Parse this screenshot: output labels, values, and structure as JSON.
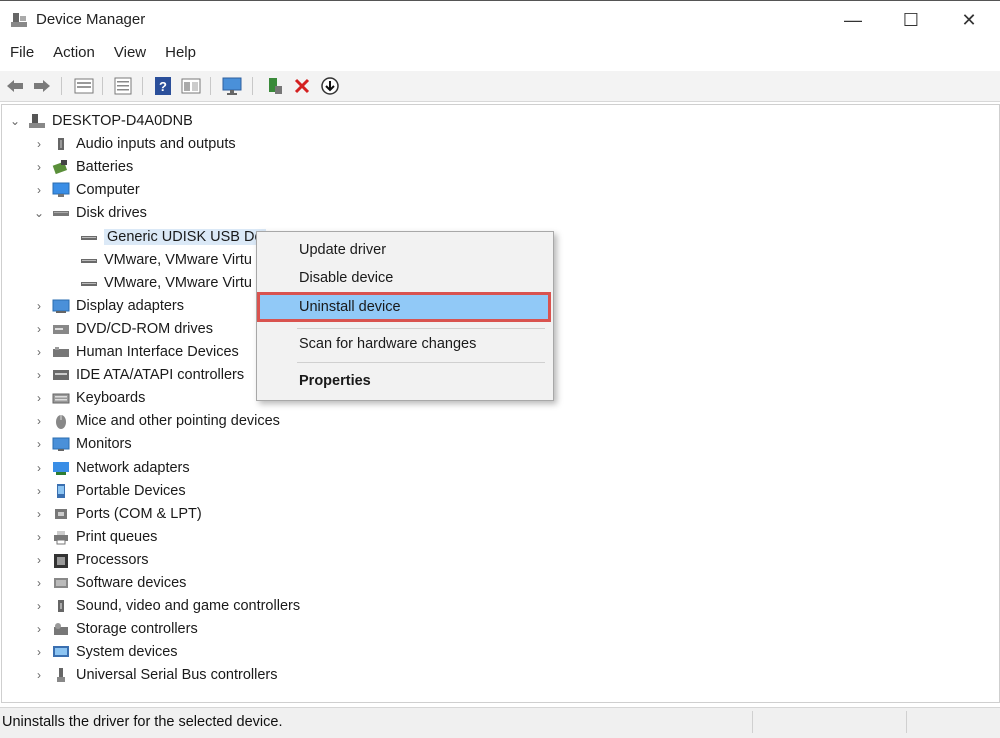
{
  "window": {
    "title": "Device Manager",
    "minimize_glyph": "—",
    "maximize_glyph": "☐",
    "close_glyph": "✕"
  },
  "menu": [
    "File",
    "Action",
    "View",
    "Help"
  ],
  "toolbar": {
    "icons": [
      "back-arrow-icon",
      "forward-arrow-icon",
      "properties-grid-icon",
      "list-view-icon",
      "help-icon",
      "resources-icon",
      "monitor-scan-icon",
      "update-driver-icon",
      "uninstall-x-icon",
      "download-icon"
    ]
  },
  "tree": {
    "root": "DESKTOP-D4A0DNB",
    "categories": [
      {
        "label": "Audio inputs and outputs",
        "icon": "speaker-icon",
        "expanded": false
      },
      {
        "label": "Batteries",
        "icon": "battery-icon",
        "expanded": false
      },
      {
        "label": "Computer",
        "icon": "computer-icon",
        "expanded": false
      },
      {
        "label": "Disk drives",
        "icon": "disk-drive-icon",
        "expanded": true,
        "children": [
          "Generic UDISK USB De",
          "VMware, VMware Virtu",
          "VMware, VMware Virtu"
        ]
      },
      {
        "label": "Display adapters",
        "icon": "display-adapter-icon",
        "expanded": false
      },
      {
        "label": "DVD/CD-ROM drives",
        "icon": "dvd-drive-icon",
        "expanded": false
      },
      {
        "label": "Human Interface Devices",
        "icon": "hid-icon",
        "expanded": false
      },
      {
        "label": "IDE ATA/ATAPI controllers",
        "icon": "ide-controller-icon",
        "expanded": false
      },
      {
        "label": "Keyboards",
        "icon": "keyboard-icon",
        "expanded": false
      },
      {
        "label": "Mice and other pointing devices",
        "icon": "mouse-icon",
        "expanded": false
      },
      {
        "label": "Monitors",
        "icon": "monitor-icon",
        "expanded": false
      },
      {
        "label": "Network adapters",
        "icon": "network-adapter-icon",
        "expanded": false
      },
      {
        "label": "Portable Devices",
        "icon": "portable-device-icon",
        "expanded": false
      },
      {
        "label": "Ports (COM & LPT)",
        "icon": "port-icon",
        "expanded": false
      },
      {
        "label": "Print queues",
        "icon": "printer-icon",
        "expanded": false
      },
      {
        "label": "Processors",
        "icon": "processor-icon",
        "expanded": false
      },
      {
        "label": "Software devices",
        "icon": "software-device-icon",
        "expanded": false
      },
      {
        "label": "Sound, video and game controllers",
        "icon": "sound-icon",
        "expanded": false
      },
      {
        "label": "Storage controllers",
        "icon": "storage-controller-icon",
        "expanded": false
      },
      {
        "label": "System devices",
        "icon": "system-device-icon",
        "expanded": false
      },
      {
        "label": "Universal Serial Bus controllers",
        "icon": "usb-icon",
        "expanded": false
      }
    ]
  },
  "context_menu": {
    "items": [
      {
        "label": "Update driver"
      },
      {
        "label": "Disable device"
      },
      {
        "label": "Uninstall device",
        "highlighted": true
      },
      {
        "label": "Scan for hardware changes"
      },
      {
        "label": "Properties",
        "bold": true
      }
    ]
  },
  "status_bar": {
    "text": "Uninstalls the driver for the selected device."
  },
  "colors": {
    "highlight_fill": "#91c9f7",
    "highlight_border": "#d9534f",
    "selection": "#dbe9f7"
  }
}
